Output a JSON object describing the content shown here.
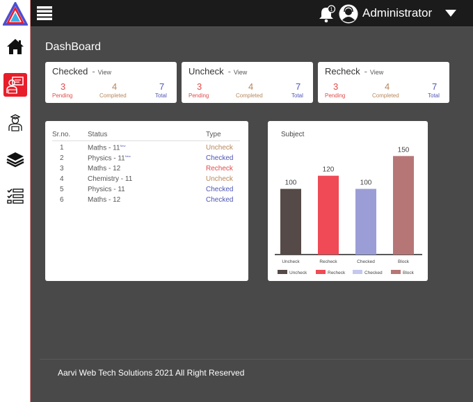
{
  "header": {
    "user_name": "Administrator",
    "bell_badge": "1"
  },
  "page_title": "DashBoard",
  "cards": [
    {
      "title": "Checked",
      "view_label": "View",
      "pending": "3",
      "pending_label": "Pending",
      "completed": "4",
      "completed_label": "Completed",
      "total": "7",
      "total_label": "Total"
    },
    {
      "title": "Uncheck",
      "view_label": "View",
      "pending": "3",
      "pending_label": "Pending",
      "completed": "4",
      "completed_label": "Completed",
      "total": "7",
      "total_label": "Total"
    },
    {
      "title": "Recheck",
      "view_label": "View",
      "pending": "3",
      "pending_label": "Pending",
      "completed": "4",
      "completed_label": "Completed",
      "total": "7",
      "total_label": "Total"
    }
  ],
  "table": {
    "headers": [
      "Sr.no.",
      "Status",
      "Type"
    ],
    "rows": [
      {
        "no": "1",
        "status": "Maths - 11",
        "tag": "New",
        "type": "Uncheck"
      },
      {
        "no": "2",
        "status": "Physics - 11",
        "tag": "New",
        "type": "Checked"
      },
      {
        "no": "3",
        "status": "Maths - 12",
        "tag": "",
        "type": "Recheck"
      },
      {
        "no": "4",
        "status": "Chemistry - 11",
        "tag": "",
        "type": "Uncheck"
      },
      {
        "no": "5",
        "status": "Physics - 11",
        "tag": "",
        "type": "Checked"
      },
      {
        "no": "6",
        "status": "Maths - 12",
        "tag": "",
        "type": "Checked"
      }
    ]
  },
  "chart_data": {
    "type": "bar",
    "title": "Subject",
    "categories": [
      "Uncheck",
      "Recheck",
      "Checked",
      "Block"
    ],
    "values": [
      100,
      120,
      100,
      150
    ],
    "colors": [
      "#554a47",
      "#ef4a55",
      "#9b9ed6",
      "#b77676"
    ],
    "legend_colors": [
      "#554a47",
      "#ef4a55",
      "#c5c8ee",
      "#b77676"
    ],
    "ylim": [
      0,
      180
    ],
    "grid": false,
    "legend_position": "bottom"
  },
  "footer": {
    "text": "Aarvi Web Tech Solutions 2021 All Right Reserved"
  }
}
